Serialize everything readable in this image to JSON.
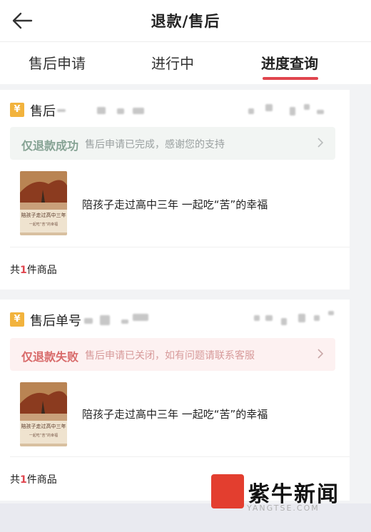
{
  "header": {
    "title": "退款/售后"
  },
  "tabs": [
    {
      "label": "售后申请"
    },
    {
      "label": "进行中"
    },
    {
      "label": "进度查询"
    }
  ],
  "colors": {
    "accent": "#e0454e",
    "badge": "#f2b33d",
    "success_text": "#86a394",
    "fail_text": "#d86a6a"
  },
  "cards": [
    {
      "badge": "¥",
      "order_label": "售后",
      "status_title": "仅退款成功",
      "status_desc": "售后申请已完成，感谢您的支持",
      "product_title": "陪孩子走过高中三年 一起吃“苦”的幸福",
      "count_prefix": "共",
      "count_num": "1",
      "count_suffix": "件商品"
    },
    {
      "badge": "¥",
      "order_label": "售后单号",
      "status_title": "仅退款失败",
      "status_desc": "售后申请已关闭，如有问题请联系客服",
      "product_title": "陪孩子走过高中三年 一起吃“苦”的幸福",
      "count_prefix": "共",
      "count_num": "1",
      "count_suffix": "件商品"
    }
  ],
  "book_cover": {
    "title": "陪孩子走过高中三年",
    "sub": "一起吃“苦”的幸福"
  },
  "watermark": {
    "logo_text": "紫牛",
    "name": "紫牛新闻",
    "sub": "YANGTSE.COM"
  }
}
